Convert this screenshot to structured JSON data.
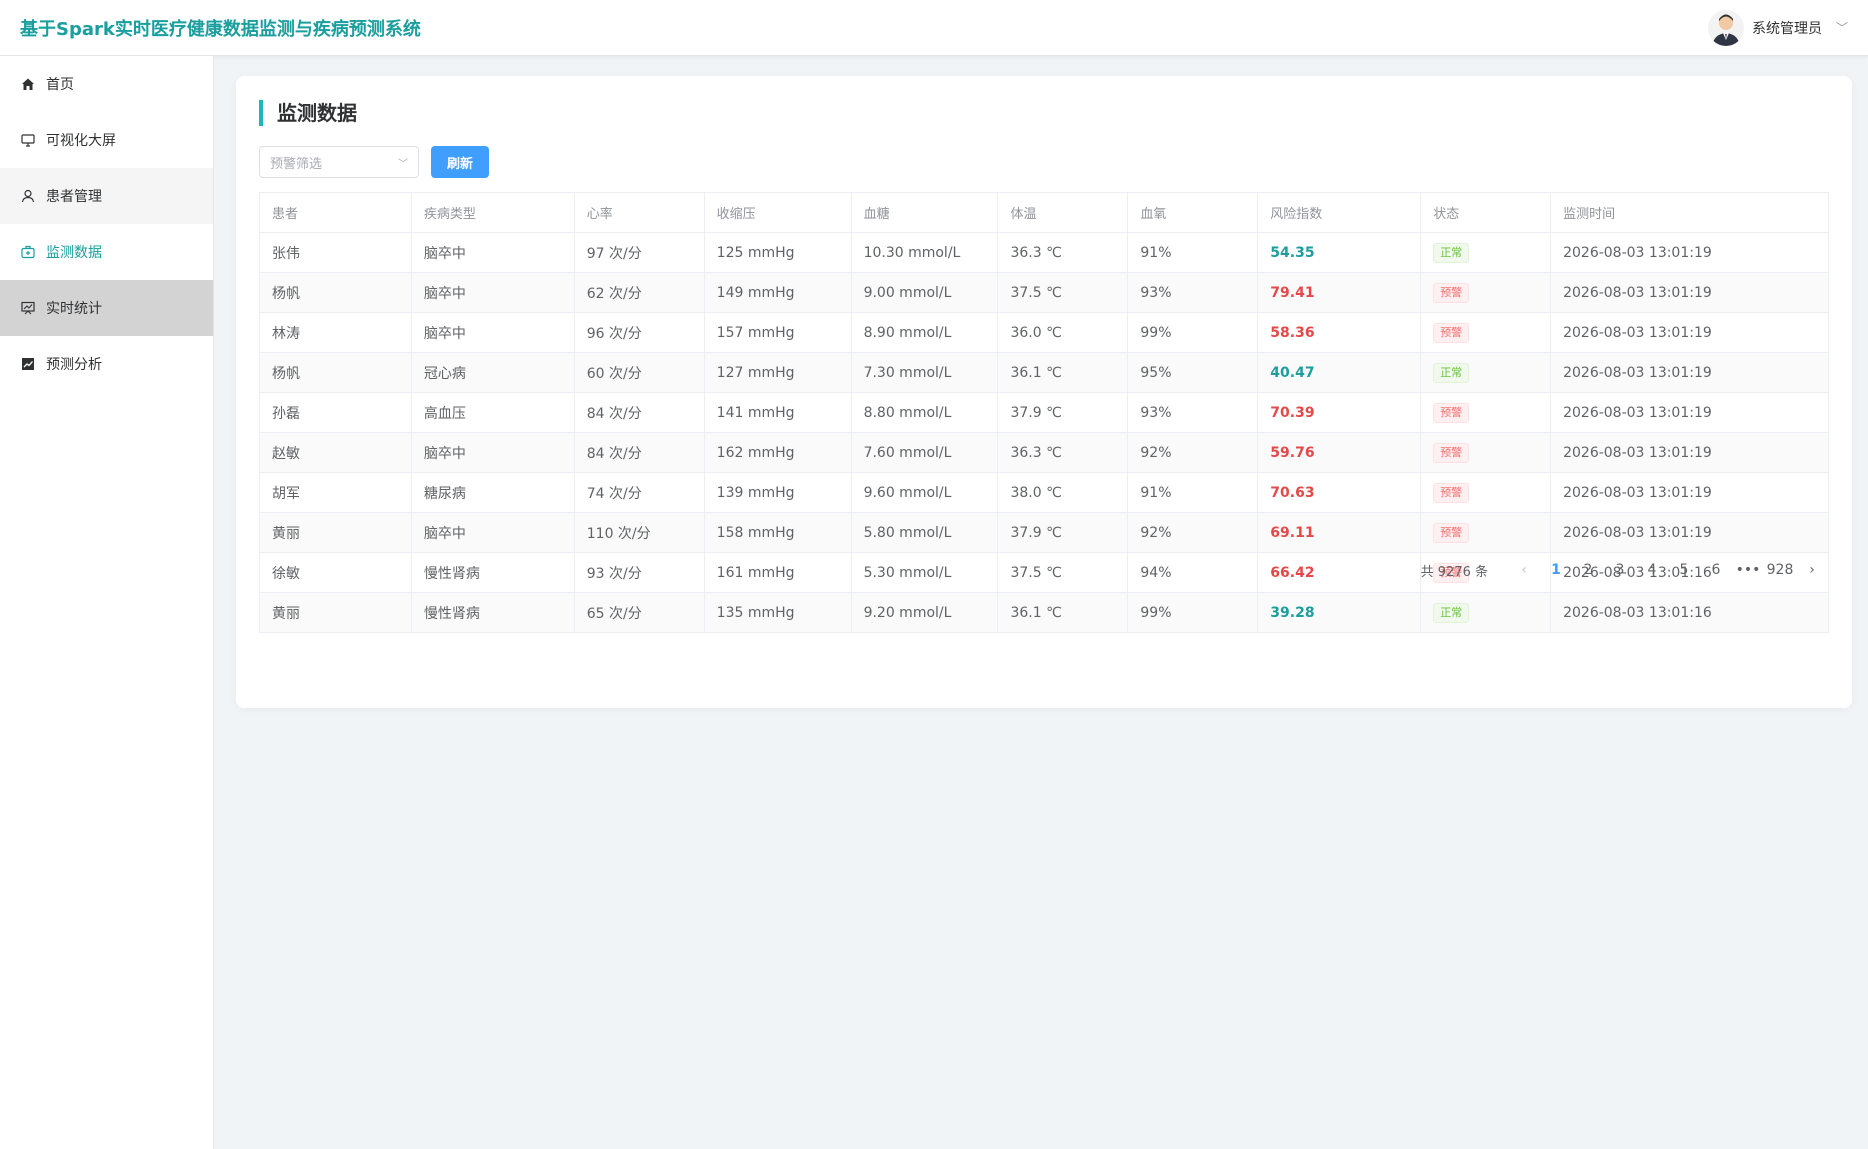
{
  "header": {
    "app_title": "基于Spark实时医疗健康数据监测与疾病预测系统",
    "user_name": "系统管理员"
  },
  "sidebar": {
    "items": [
      {
        "label": "首页",
        "icon": "home-icon"
      },
      {
        "label": "可视化大屏",
        "icon": "monitor-icon"
      },
      {
        "label": "患者管理",
        "icon": "user-icon"
      },
      {
        "label": "监测数据",
        "icon": "medical-kit-icon"
      },
      {
        "label": "实时统计",
        "icon": "chart-board-icon"
      },
      {
        "label": "预测分析",
        "icon": "trend-chart-icon"
      }
    ]
  },
  "main": {
    "title": "监测数据",
    "filter_placeholder": "预警筛选",
    "refresh_label": "刷新",
    "columns": [
      "患者",
      "疾病类型",
      "心率",
      "收缩压",
      "血糖",
      "体温",
      "血氧",
      "风险指数",
      "状态",
      "监测时间"
    ],
    "rows": [
      {
        "patient": "张伟",
        "disease": "脑卒中",
        "hr": "97 次/分",
        "sbp": "125 mmHg",
        "glucose": "10.30 mmol/L",
        "temp": "36.3 ℃",
        "spo2": "91%",
        "risk": "54.35",
        "status": "正常",
        "time": "2026-08-03 13:01:19"
      },
      {
        "patient": "杨帆",
        "disease": "脑卒中",
        "hr": "62 次/分",
        "sbp": "149 mmHg",
        "glucose": "9.00 mmol/L",
        "temp": "37.5 ℃",
        "spo2": "93%",
        "risk": "79.41",
        "status": "预警",
        "time": "2026-08-03 13:01:19"
      },
      {
        "patient": "林涛",
        "disease": "脑卒中",
        "hr": "96 次/分",
        "sbp": "157 mmHg",
        "glucose": "8.90 mmol/L",
        "temp": "36.0 ℃",
        "spo2": "99%",
        "risk": "58.36",
        "status": "预警",
        "time": "2026-08-03 13:01:19"
      },
      {
        "patient": "杨帆",
        "disease": "冠心病",
        "hr": "60 次/分",
        "sbp": "127 mmHg",
        "glucose": "7.30 mmol/L",
        "temp": "36.1 ℃",
        "spo2": "95%",
        "risk": "40.47",
        "status": "正常",
        "time": "2026-08-03 13:01:19"
      },
      {
        "patient": "孙磊",
        "disease": "高血压",
        "hr": "84 次/分",
        "sbp": "141 mmHg",
        "glucose": "8.80 mmol/L",
        "temp": "37.9 ℃",
        "spo2": "93%",
        "risk": "70.39",
        "status": "预警",
        "time": "2026-08-03 13:01:19"
      },
      {
        "patient": "赵敏",
        "disease": "脑卒中",
        "hr": "84 次/分",
        "sbp": "162 mmHg",
        "glucose": "7.60 mmol/L",
        "temp": "36.3 ℃",
        "spo2": "92%",
        "risk": "59.76",
        "status": "预警",
        "time": "2026-08-03 13:01:19"
      },
      {
        "patient": "胡军",
        "disease": "糖尿病",
        "hr": "74 次/分",
        "sbp": "139 mmHg",
        "glucose": "9.60 mmol/L",
        "temp": "38.0 ℃",
        "spo2": "91%",
        "risk": "70.63",
        "status": "预警",
        "time": "2026-08-03 13:01:19"
      },
      {
        "patient": "黄丽",
        "disease": "脑卒中",
        "hr": "110 次/分",
        "sbp": "158 mmHg",
        "glucose": "5.80 mmol/L",
        "temp": "37.9 ℃",
        "spo2": "92%",
        "risk": "69.11",
        "status": "预警",
        "time": "2026-08-03 13:01:19"
      },
      {
        "patient": "徐敏",
        "disease": "慢性肾病",
        "hr": "93 次/分",
        "sbp": "161 mmHg",
        "glucose": "5.30 mmol/L",
        "temp": "37.5 ℃",
        "spo2": "94%",
        "risk": "66.42",
        "status": "预警",
        "time": "2026-08-03 13:01:16"
      },
      {
        "patient": "黄丽",
        "disease": "慢性肾病",
        "hr": "65 次/分",
        "sbp": "135 mmHg",
        "glucose": "9.20 mmol/L",
        "temp": "36.1 ℃",
        "spo2": "99%",
        "risk": "39.28",
        "status": "正常",
        "time": "2026-08-03 13:01:16"
      }
    ],
    "pagination": {
      "total_text": "共 9276 条",
      "pages": [
        "1",
        "2",
        "3",
        "4",
        "5",
        "6",
        "•••",
        "928"
      ],
      "current": "1"
    }
  },
  "colors": {
    "accent": "#1a9e9e",
    "primary": "#409eff",
    "warn": "#e54848",
    "ok": "#67c23a"
  }
}
